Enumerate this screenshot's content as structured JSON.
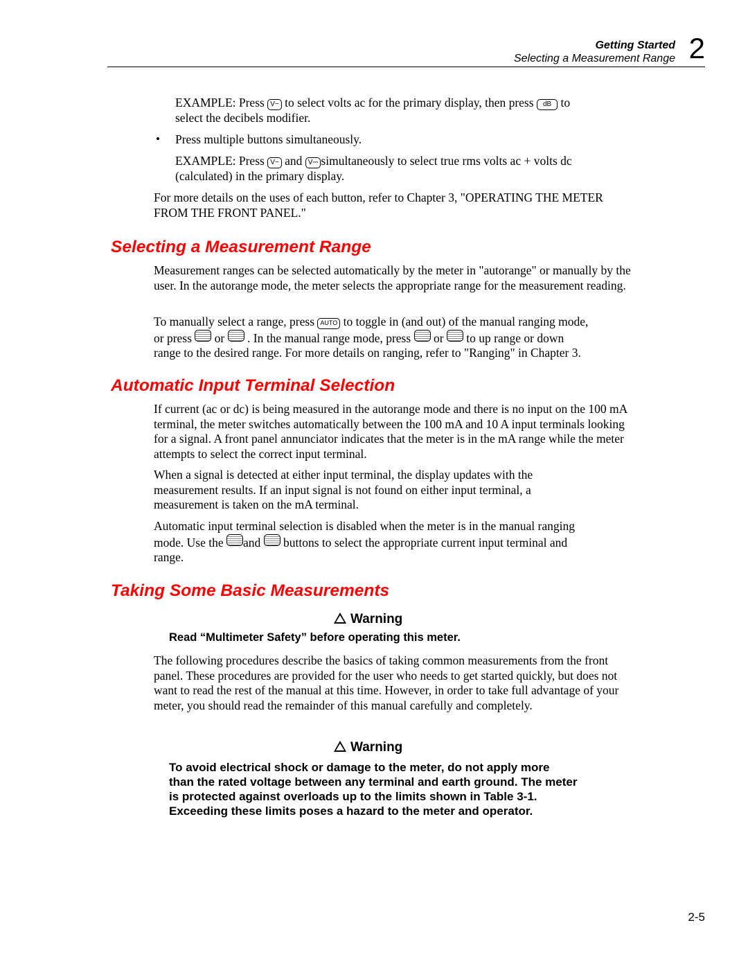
{
  "header": {
    "chapter_title": "Getting Started",
    "section_title": "Selecting a Measurement Range",
    "chapter_number": "2"
  },
  "intro": {
    "example1_a": "EXAMPLE: Press",
    "key_vac": "V~",
    "example1_b": "to select volts ac for the primary display, then press",
    "key_db": "dB",
    "example1_c": "to",
    "example1_d": "select the decibels modifier.",
    "bullet": "Press multiple buttons simultaneously.",
    "example2_a": "EXAMPLE: Press",
    "example2_b": "and",
    "key_vdc": "V⎓",
    "example2_c": "simultaneously to select true rms volts ac + volts dc",
    "example2_d": "(calculated) in the primary display.",
    "more_details": "For more details on the uses of each button, refer to Chapter 3, \"OPERATING THE METER FROM THE FRONT PANEL.\""
  },
  "section_range": {
    "title": "Selecting a Measurement Range",
    "para1": "Measurement ranges can be selected automatically by the meter in \"autorange\" or manually by the user. In the autorange mode, the meter selects the appropriate range for the measurement reading.",
    "para2_a": "To manually select a range, press",
    "key_auto": "AUTO",
    "para2_b": "to toggle in (and out) of the manual ranging mode,",
    "para2_c": "or press",
    "or": "or",
    "para2_d": ". In the manual range mode, press",
    "para2_e": "to up range or down",
    "para2_f": "range to the desired range. For more details on ranging, refer to \"Ranging\" in Chapter 3."
  },
  "section_terminal": {
    "title": "Automatic Input Terminal Selection",
    "para1": "If current (ac or dc) is being measured in the autorange mode and there is no input on the 100 mA terminal, the meter switches automatically between the 100 mA and 10 A input terminals looking for a signal. A front panel annunciator indicates that the meter is in the mA range while the meter attempts to select the correct input terminal.",
    "para2": "When a signal is detected at either input terminal, the display updates with the measurement results. If an input signal is not found on either input terminal, a measurement is taken on the mA terminal.",
    "para3_a": "Automatic input terminal selection is disabled when the meter is in the manual ranging",
    "para3_b": "mode. Use the",
    "para3_c": "and",
    "para3_d": "buttons to select the appropriate current input terminal and",
    "para3_e": "range."
  },
  "section_basic": {
    "title": "Taking Some Basic Measurements",
    "warning1_label": "Warning",
    "warning1_text": "Read “Multimeter Safety” before operating this meter.",
    "para1": "The following procedures describe the basics of taking common measurements from the front panel. These procedures are provided for the user who needs to get started quickly, but does not want to read the rest of the manual at this time. However, in order to take full advantage of your meter, you should read the remainder of this manual carefully and completely.",
    "warning2_label": "Warning",
    "warning2_text": "To avoid electrical shock or damage to the meter, do not apply more than the rated voltage between any terminal and earth ground. The meter is protected against overloads up to the limits shown in Table 3-1. Exceeding these limits poses a hazard to the meter and operator."
  },
  "footer": {
    "page_number": "2-5"
  }
}
